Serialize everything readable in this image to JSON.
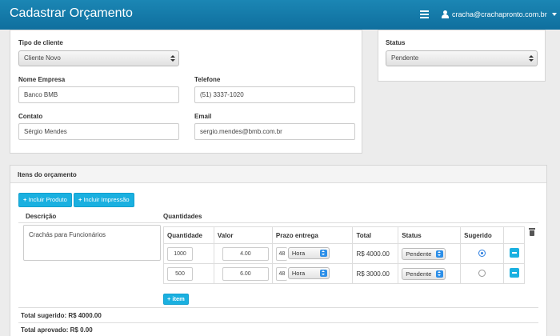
{
  "header": {
    "title": "Cadastrar Orçamento",
    "user_email": "cracha@crachapronto.com.br"
  },
  "form": {
    "tipo_cliente": {
      "label": "Tipo de cliente",
      "value": "Cliente Novo"
    },
    "nome_empresa": {
      "label": "Nome Empresa",
      "value": "Banco BMB"
    },
    "telefone": {
      "label": "Telefone",
      "value": "(51) 3337-1020"
    },
    "contato": {
      "label": "Contato",
      "value": "Sérgio Mendes"
    },
    "email": {
      "label": "Email",
      "value": "sergio.mendes@bmb.com.br"
    }
  },
  "status_panel": {
    "label": "Status",
    "value": "Pendente"
  },
  "items": {
    "title": "Itens do orçamento",
    "btn_produto": "Incluir Produto",
    "btn_impressao": "Incluir Impressão",
    "descricao_label": "Descrição",
    "descricao_value": "Crachás para Funcionários",
    "quantidades_label": "Quantidades",
    "columns": [
      "Quantidade",
      "Valor",
      "Prazo entrega",
      "Total",
      "Status",
      "Sugerido"
    ],
    "rows": [
      {
        "quantidade": "1000",
        "valor": "4.00",
        "prazo": "48",
        "unidade": "Hora",
        "total": "R$ 4000.00",
        "status": "Pendente",
        "sugerido": true
      },
      {
        "quantidade": "500",
        "valor": "6.00",
        "prazo": "48",
        "unidade": "Hora",
        "total": "R$ 3000.00",
        "status": "Pendente",
        "sugerido": false
      }
    ],
    "btn_item": "item"
  },
  "totals": {
    "sugerido": "Total sugerido: R$ 4000.00",
    "aprovado": "Total aprovado: R$ 0.00"
  }
}
